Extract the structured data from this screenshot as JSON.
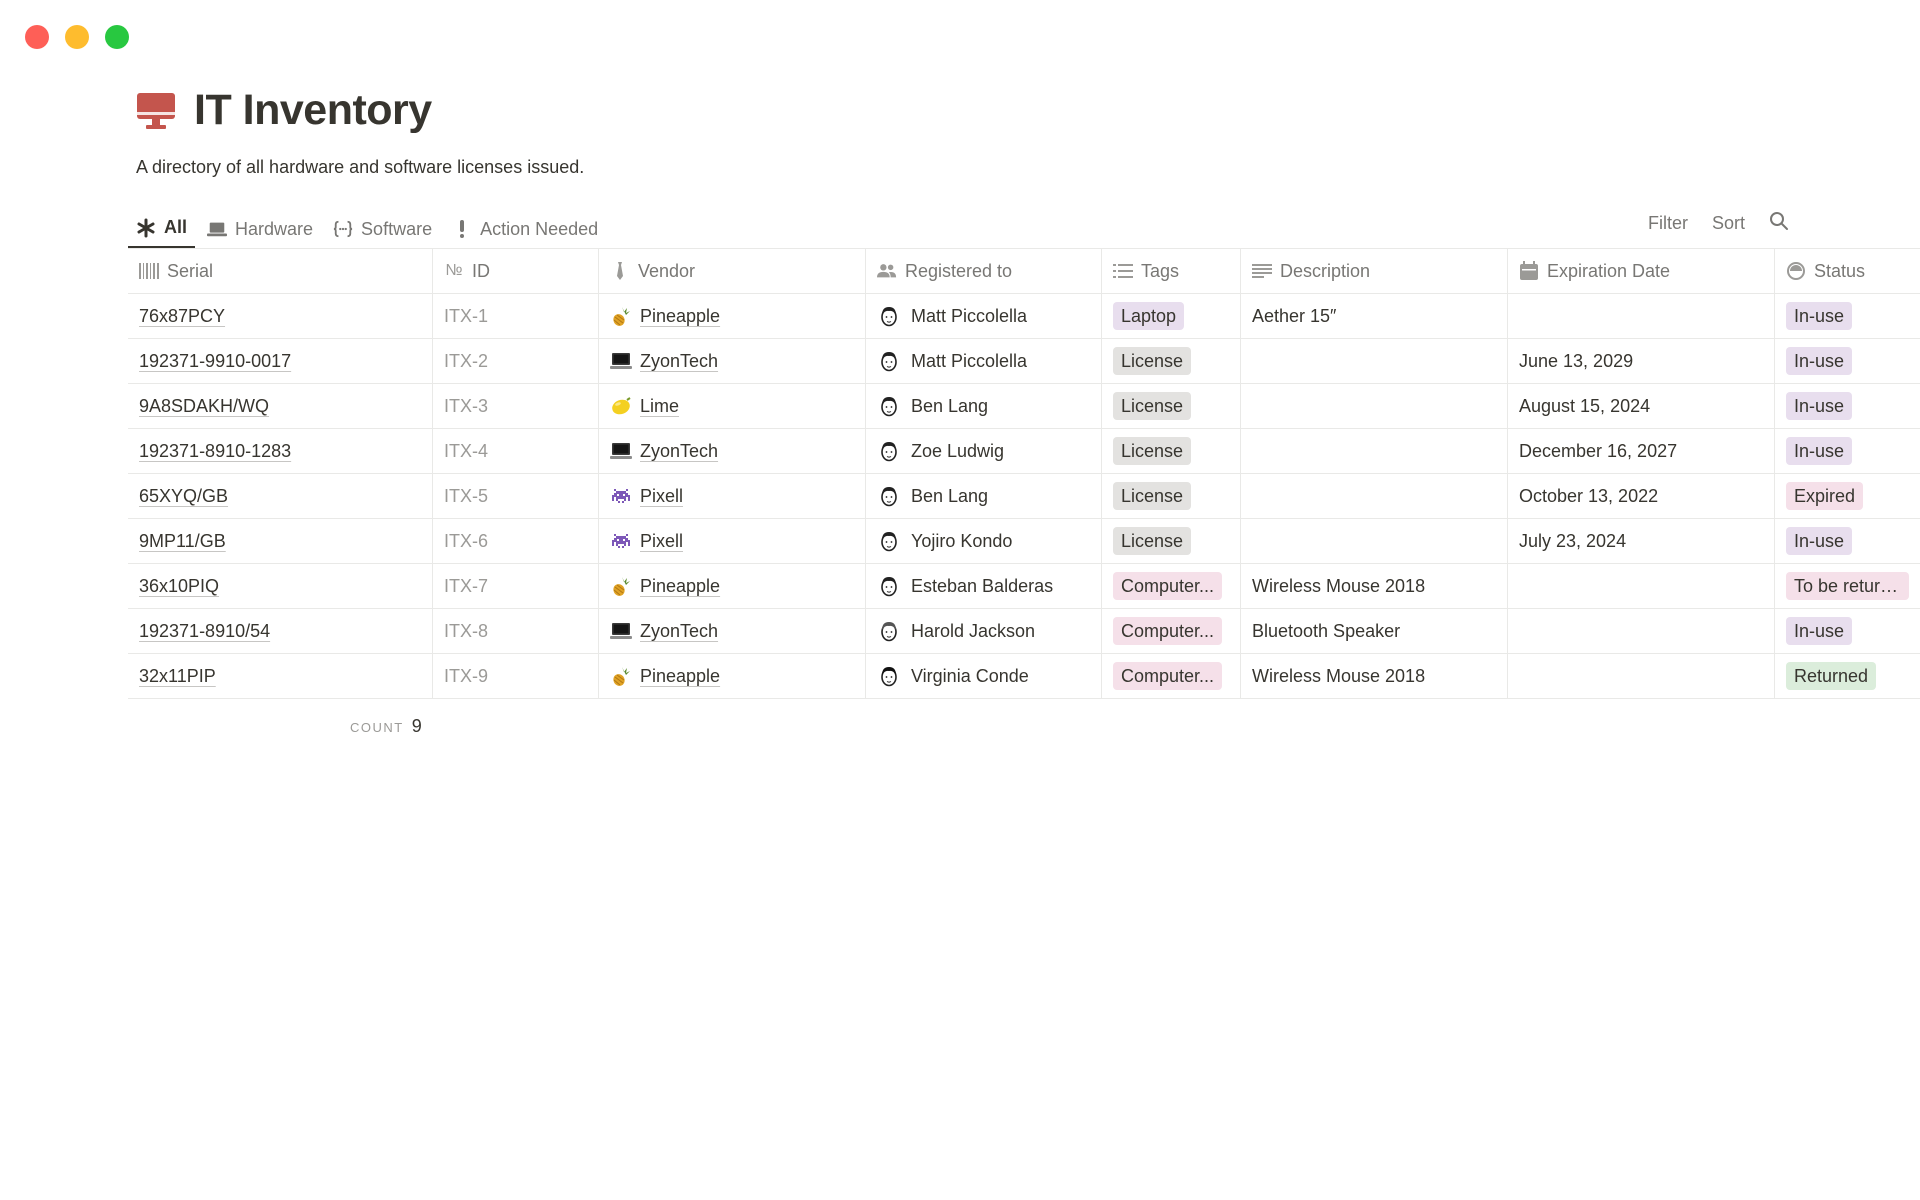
{
  "page": {
    "title": "IT Inventory",
    "subtitle": "A directory of all hardware and software licenses issued.",
    "icon": "desktop-monitor-icon",
    "icon_color": "#c4554d"
  },
  "views": {
    "tabs": [
      {
        "label": "All",
        "icon": "asterisk-icon",
        "active": true
      },
      {
        "label": "Hardware",
        "icon": "laptop-icon",
        "active": false
      },
      {
        "label": "Software",
        "icon": "code-braces-icon",
        "active": false
      },
      {
        "label": "Action Needed",
        "icon": "exclamation-icon",
        "active": false
      }
    ],
    "actions": {
      "filter": "Filter",
      "sort": "Sort",
      "search_icon": "search-icon"
    }
  },
  "table": {
    "columns": [
      {
        "label": "Serial",
        "icon": "barcode-icon"
      },
      {
        "label": "ID",
        "icon": "number-icon",
        "prefix": "№"
      },
      {
        "label": "Vendor",
        "icon": "tie-icon"
      },
      {
        "label": "Registered to",
        "icon": "people-icon"
      },
      {
        "label": "Tags",
        "icon": "list-icon"
      },
      {
        "label": "Description",
        "icon": "text-icon"
      },
      {
        "label": "Expiration Date",
        "icon": "calendar-icon"
      },
      {
        "label": "Status",
        "icon": "status-icon"
      }
    ],
    "rows": [
      {
        "serial": "76x87PCY",
        "id": "ITX-1",
        "vendor": "Pineapple",
        "vendor_icon": "pineapple-icon",
        "registered_to": "Matt Piccolella",
        "tag": "Laptop",
        "tag_style": "laptop",
        "description": "Aether 15″",
        "expiration": "",
        "status": "In-use",
        "status_style": "inuse"
      },
      {
        "serial": "192371-9910-0017",
        "id": "ITX-2",
        "vendor": "ZyonTech",
        "vendor_icon": "laptop-icon",
        "registered_to": "Matt Piccolella",
        "tag": "License",
        "tag_style": "license",
        "description": "",
        "expiration": "June 13, 2029",
        "status": "In-use",
        "status_style": "inuse"
      },
      {
        "serial": "9A8SDAKH/WQ",
        "id": "ITX-3",
        "vendor": "Lime",
        "vendor_icon": "lemon-icon",
        "registered_to": "Ben Lang",
        "tag": "License",
        "tag_style": "license",
        "description": "",
        "expiration": "August 15, 2024",
        "status": "In-use",
        "status_style": "inuse"
      },
      {
        "serial": "192371-8910-1283",
        "id": "ITX-4",
        "vendor": "ZyonTech",
        "vendor_icon": "laptop-icon",
        "registered_to": "Zoe Ludwig",
        "tag": "License",
        "tag_style": "license",
        "description": "",
        "expiration": "December 16, 2027",
        "status": "In-use",
        "status_style": "inuse"
      },
      {
        "serial": "65XYQ/GB",
        "id": "ITX-5",
        "vendor": "Pixell",
        "vendor_icon": "space-invader-icon",
        "registered_to": "Ben Lang",
        "tag": "License",
        "tag_style": "license",
        "description": "",
        "expiration": "October 13, 2022",
        "status": "Expired",
        "status_style": "expired"
      },
      {
        "serial": "9MP11/GB",
        "id": "ITX-6",
        "vendor": "Pixell",
        "vendor_icon": "space-invader-icon",
        "registered_to": "Yojiro Kondo",
        "tag": "License",
        "tag_style": "license",
        "description": "",
        "expiration": "July 23, 2024",
        "status": "In-use",
        "status_style": "inuse"
      },
      {
        "serial": "36x10PIQ",
        "id": "ITX-7",
        "vendor": "Pineapple",
        "vendor_icon": "pineapple-icon",
        "registered_to": "Esteban Balderas",
        "tag": "Computer...",
        "tag_style": "computer",
        "description": "Wireless Mouse 2018",
        "expiration": "",
        "status": "To be returned",
        "status_style": "tbr"
      },
      {
        "serial": "192371-8910/54",
        "id": "ITX-8",
        "vendor": "ZyonTech",
        "vendor_icon": "laptop-icon",
        "registered_to": "Harold Jackson",
        "tag": "Computer...",
        "tag_style": "computer",
        "description": "Bluetooth Speaker",
        "expiration": "",
        "status": "In-use",
        "status_style": "inuse"
      },
      {
        "serial": "32x11PIP",
        "id": "ITX-9",
        "vendor": "Pineapple",
        "vendor_icon": "pineapple-icon",
        "registered_to": "Virginia Conde",
        "tag": "Computer...",
        "tag_style": "computer",
        "description": "Wireless Mouse 2018",
        "expiration": "",
        "status": "Returned",
        "status_style": "returned"
      }
    ],
    "footer": {
      "count_label": "COUNT",
      "count_value": "9"
    }
  }
}
